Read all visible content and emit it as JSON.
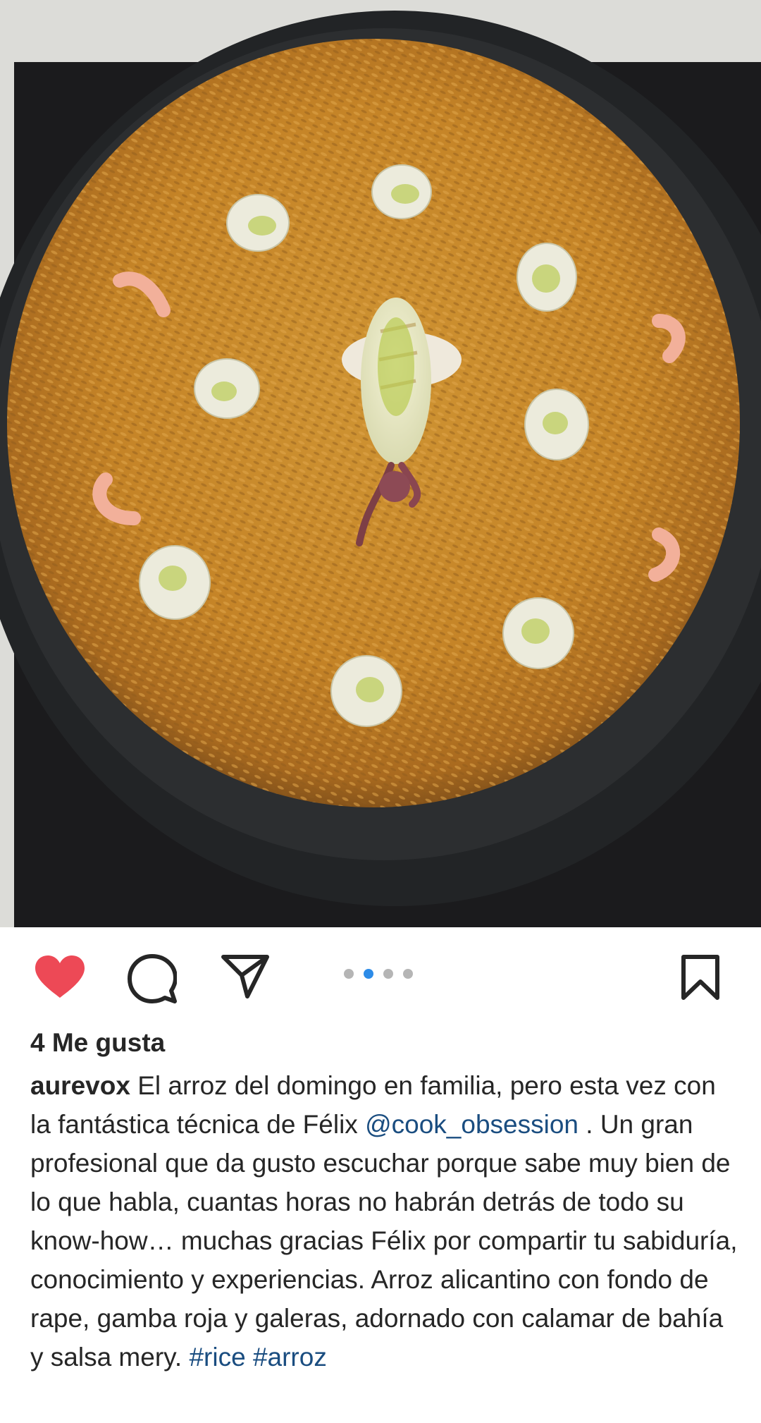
{
  "post": {
    "image_alt": "Paella de arroz alicantino con gambas, galeras y calamar",
    "carousel": {
      "count": 4,
      "active_index": 1
    },
    "likes_label": "4 Me gusta",
    "caption": {
      "username": "aurevox",
      "text_part1": " El arroz del domingo en familia, pero esta vez con la fantástica técnica de Félix ",
      "mention": "@cook_obsession",
      "text_part2": " . Un gran profesional que da gusto escuchar porque sabe muy bien de lo que habla, cuantas horas no habrán detrás de todo su know-how… muchas gracias Félix por compartir tu sabiduría, conocimiento y experiencias. Arroz alicantino con fondo de rape, gamba roja y galeras, adornado con calamar de bahía y salsa mery. ",
      "hashtag1": "#rice",
      "hashtag2": "#arroz"
    }
  },
  "icons": {
    "like": "heart-filled-icon",
    "comment": "speech-bubble-icon",
    "share": "paper-plane-icon",
    "save": "bookmark-icon"
  },
  "colors": {
    "heart": "#ed4956",
    "active_dot": "#2d8ce8",
    "link": "#1a4d80",
    "rice": "#c9882a"
  }
}
